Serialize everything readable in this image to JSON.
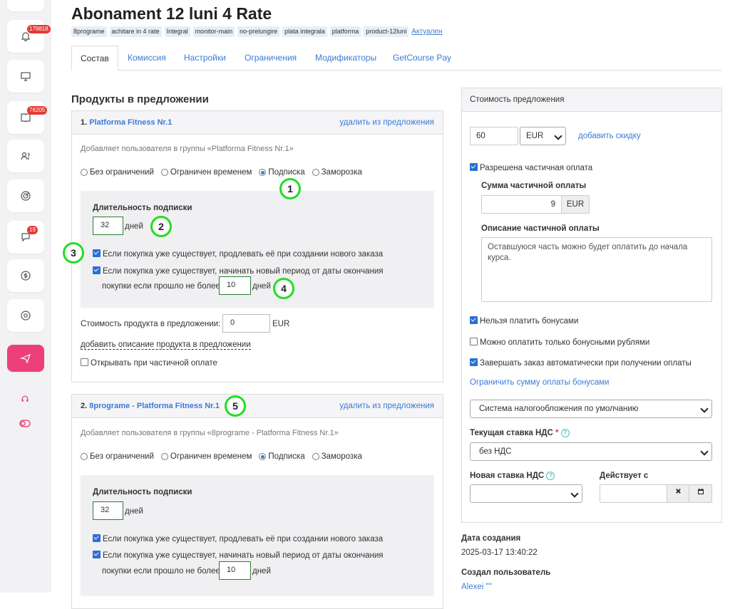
{
  "sidebar": {
    "badges": {
      "notifications": "179818",
      "inbox": "76205",
      "chat": "19"
    }
  },
  "page": {
    "title": "Abonament 12 luni 4 Rate",
    "tags": [
      "8programe",
      "achitare in 4 rate",
      "Integral",
      "monitor-main",
      "no-prelungire",
      "plata integrala",
      "platforma",
      "product-12luni"
    ],
    "status": "Актуален"
  },
  "tabs": [
    "Состав",
    "Комиссия",
    "Настройки",
    "Ограничения",
    "Модификаторы",
    "GetCourse Pay"
  ],
  "products_section": {
    "title": "Продукты в предложении",
    "products": [
      {
        "num": "1.",
        "name": "Platforma Fitness Nr.1",
        "delete_label": "удалить из предложения",
        "groups_text": "Добавляет пользователя в группы «Platforma Fitness Nr.1»",
        "radios": [
          "Без ограничений",
          "Ограничен временем",
          "Подписка",
          "Заморозка"
        ],
        "duration_label": "Длительность подписки",
        "duration_value": "32",
        "days": "дней",
        "extend_label": "Если покупка уже существует, продлевать её при создании нового заказа",
        "newperiod_label1": "Если покупка уже существует, начинать новый период от даты окончания",
        "newperiod_label2": "покупки если прошло не более",
        "newperiod_value": "10",
        "price_label": "Стоимость продукта в предложении:",
        "price_value": "0",
        "currency": "EUR",
        "add_desc": "добавить описание продукта в предложении",
        "open_partial": "Открывать при частичной оплате"
      },
      {
        "num": "2.",
        "name": "8programe - Platforma Fitness Nr.1",
        "delete_label": "удалить из предложения",
        "groups_text": "Добавляет пользователя в группы «8programe - Platforma Fitness Nr.1»",
        "radios": [
          "Без ограничений",
          "Ограничен временем",
          "Подписка",
          "Заморозка"
        ],
        "duration_label": "Длительность подписки",
        "duration_value": "32",
        "days": "дней",
        "extend_label": "Если покупка уже существует, продлевать её при создании нового заказа",
        "newperiod_label1": "Если покупка уже существует, начинать новый период от даты окончания",
        "newperiod_label2": "покупки если прошло не более",
        "newperiod_value": "10"
      }
    ]
  },
  "annotations": [
    "1",
    "2",
    "3",
    "4",
    "5"
  ],
  "price_panel": {
    "title": "Стоимость предложения",
    "price": "60",
    "currency": "EUR",
    "add_discount": "добавить скидку",
    "partial_allowed": "Разрешена частичная оплата",
    "partial_sum_label": "Сумма частичной оплаты",
    "partial_sum": "9",
    "partial_currency": "EUR",
    "partial_desc_label": "Описание частичной оплаты",
    "partial_desc": "Оставшуюся часть можно будет оплатить до начала курса.",
    "no_bonus": "Нельзя платить бонусами",
    "only_bonus": "Можно оплатить только бонусными рублями",
    "auto_complete": "Завершать заказ автоматически при получении оплаты",
    "limit_bonus": "Ограничить сумму оплаты бонусами",
    "tax_system": "Система налогообложения по умолчанию",
    "vat_label": "Текущая ставка НДС",
    "vat_req": "*",
    "vat_value": "без НДС",
    "new_vat_label": "Новая ставка НДС",
    "valid_from_label": "Действует с",
    "help": "?"
  },
  "meta": {
    "created_label": "Дата создания",
    "created_value": "2025-03-17 13:40:22",
    "author_label": "Создал пользователь",
    "author_value": "Alexei \"\""
  },
  "colors": {
    "accent": "#3a7bd5",
    "annotation": "#22dd22",
    "send_button": "#ec3f7a"
  }
}
